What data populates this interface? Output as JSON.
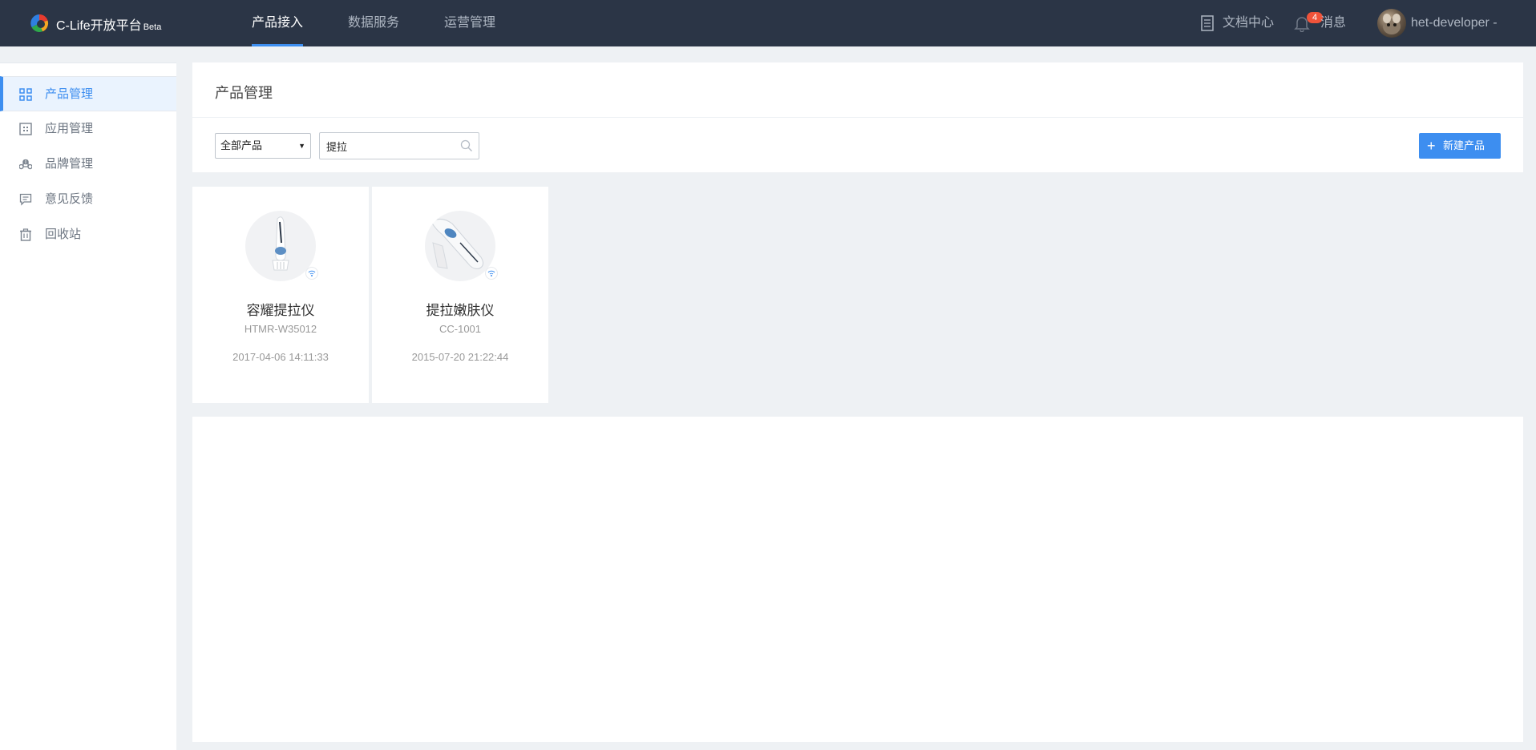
{
  "app": {
    "name": "C-Life开放平台",
    "beta": "Beta"
  },
  "nav": {
    "items": [
      {
        "label": "产品接入",
        "active": true
      },
      {
        "label": "数据服务",
        "active": false
      },
      {
        "label": "运营管理",
        "active": false
      }
    ]
  },
  "top_right": {
    "docs_label": "文档中心",
    "messages_label": "消息",
    "messages_count": "4",
    "user_name": "het-developer",
    "user_caret": "-"
  },
  "sidebar": {
    "items": [
      {
        "label": "产品管理",
        "icon": "grid-icon",
        "active": true
      },
      {
        "label": "应用管理",
        "icon": "app-icon",
        "active": false
      },
      {
        "label": "品牌管理",
        "icon": "command-icon",
        "active": false
      },
      {
        "label": "意见反馈",
        "icon": "comment-icon",
        "active": false
      },
      {
        "label": "回收站",
        "icon": "trash-icon",
        "active": false
      }
    ]
  },
  "main": {
    "title": "产品管理",
    "filter_select": "全部产品",
    "search_value": "提拉",
    "new_button": "新建产品"
  },
  "products": [
    {
      "name": "容耀提拉仪",
      "model": "HTMR-W35012",
      "created": "2017-04-06 14:11:33"
    },
    {
      "name": "提拉嫩肤仪",
      "model": "CC-1001",
      "created": "2015-07-20 21:22:44"
    }
  ],
  "colors": {
    "topbar": "#2b3546",
    "accent": "#3d8ef0",
    "badge": "#f0533a"
  }
}
